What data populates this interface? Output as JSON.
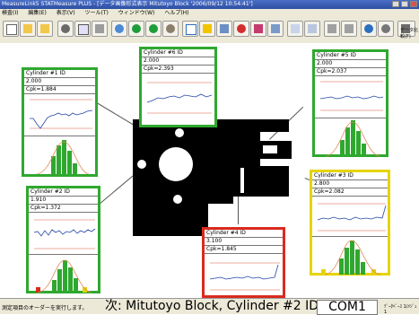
{
  "window": {
    "title": "MeasureLink5 STATMeasure PLUS - [データ画像形式表示 Mitutoyo Block '2006/09/12 10:54:41']"
  },
  "menu": {
    "items": [
      "検査(I)",
      "編集(E)",
      "表示(V)",
      "ツール(T)",
      "ウィンドウ(W)",
      "ヘルプ(H)"
    ]
  },
  "toolbar": {
    "label": "データ比較(F)"
  },
  "panels": [
    {
      "id": "p1",
      "title": "Cylinder #1 ID",
      "value": "2.000",
      "cpk": "Cpk=1.884",
      "border": "#2fa82f"
    },
    {
      "id": "p2",
      "title": "Cylinder #2 ID",
      "value": "1.910",
      "cpk": "Cpk=1.372",
      "border": "#2fa82f"
    },
    {
      "id": "p3",
      "title": "Cylinder #3 ID",
      "value": "2.800",
      "cpk": "Cpk=2.082",
      "border": "#e6d400"
    },
    {
      "id": "p4",
      "title": "Cylinder #4 ID",
      "value": "3.100",
      "cpk": "Cpk=1.845",
      "border": "#d92b1e"
    },
    {
      "id": "p5",
      "title": "Cylinder #5 ID",
      "value": "2.000",
      "cpk": "Cpk=2.037",
      "border": "#2fa82f"
    },
    {
      "id": "p6",
      "title": "Cylinder #6 ID",
      "value": "2.000",
      "cpk": "Cpk=2.393",
      "border": "#2fa82f"
    }
  ],
  "status": {
    "message": "測定項目のオーダーを実行します。",
    "next": "次: Mitutoyo Block, Cylinder #2 ID",
    "port": "COM1",
    "right": "ﾃﾞｰﾀﾍﾞｰｽ 1/ﾒｼﾞｭ1"
  }
}
